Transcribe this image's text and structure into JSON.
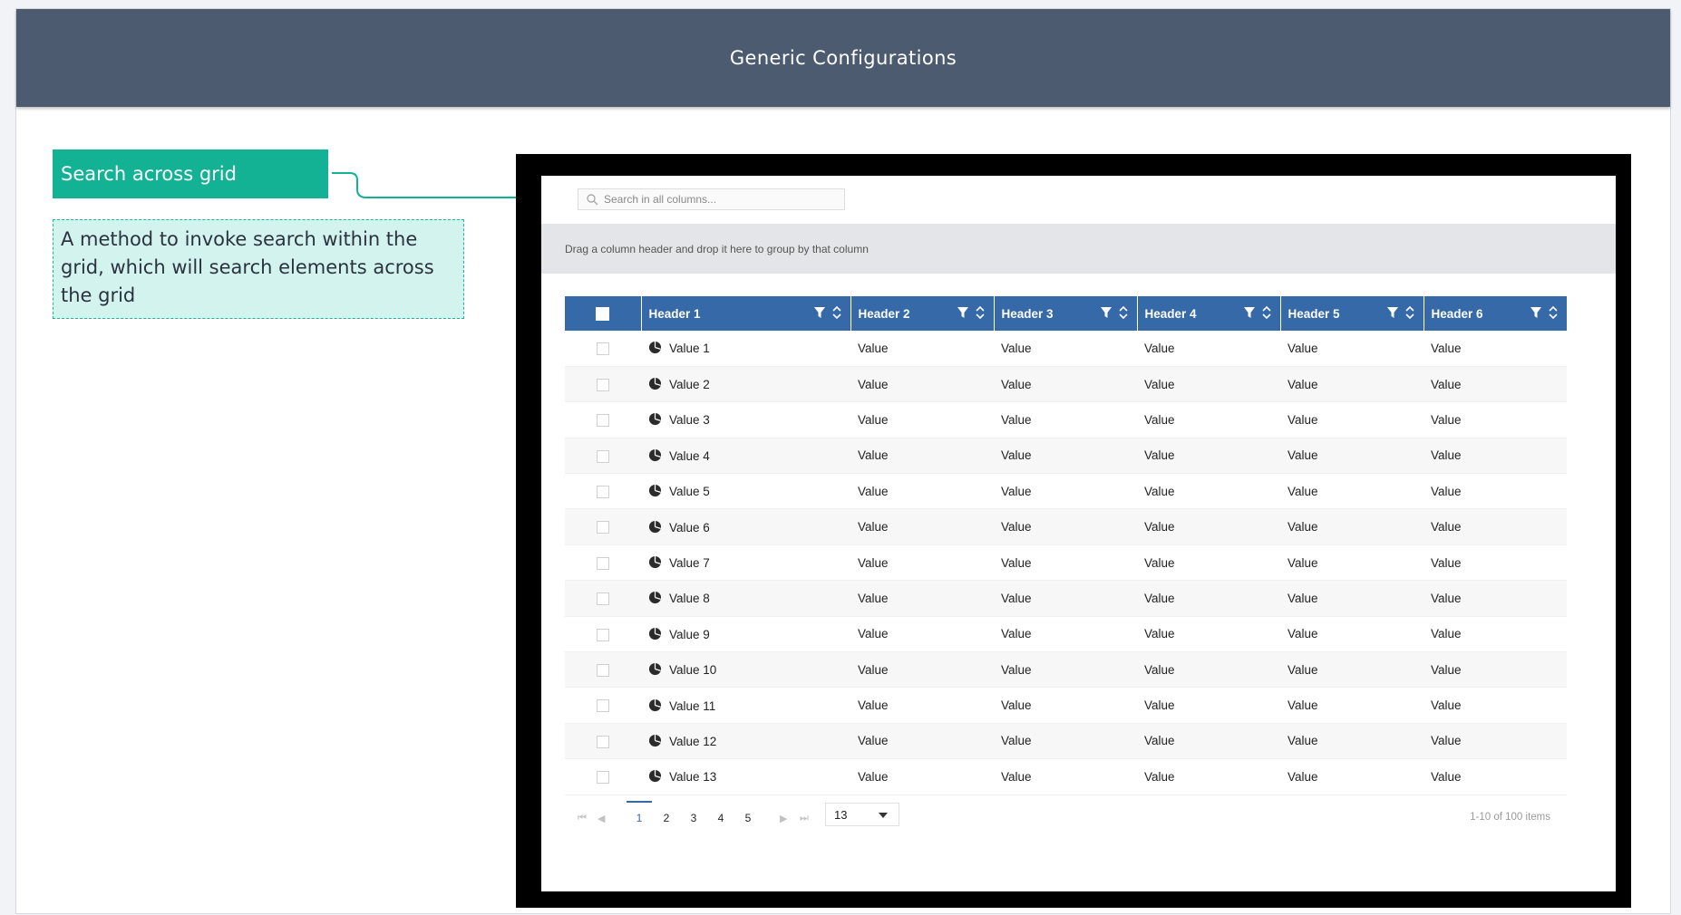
{
  "header": {
    "title": "Generic Configurations"
  },
  "callout": {
    "tag": "Search across grid",
    "description": "A method to invoke search within the grid, which will search elements  across the grid"
  },
  "grid": {
    "search_placeholder": "Search in all columns...",
    "group_hint": "Drag a column header and drop it here to group by that column",
    "headers": [
      "Header 1",
      "Header 2",
      "Header 3",
      "Header 4",
      "Header 5",
      "Header 6"
    ],
    "rows": [
      [
        "Value 1",
        "Value",
        "Value",
        "Value",
        "Value",
        "Value"
      ],
      [
        "Value 2",
        "Value",
        "Value",
        "Value",
        "Value",
        "Value"
      ],
      [
        "Value 3",
        "Value",
        "Value",
        "Value",
        "Value",
        "Value"
      ],
      [
        "Value 4",
        "Value",
        "Value",
        "Value",
        "Value",
        "Value"
      ],
      [
        "Value 5",
        "Value",
        "Value",
        "Value",
        "Value",
        "Value"
      ],
      [
        "Value 6",
        "Value",
        "Value",
        "Value",
        "Value",
        "Value"
      ],
      [
        "Value 7",
        "Value",
        "Value",
        "Value",
        "Value",
        "Value"
      ],
      [
        "Value 8",
        "Value",
        "Value",
        "Value",
        "Value",
        "Value"
      ],
      [
        "Value 9",
        "Value",
        "Value",
        "Value",
        "Value",
        "Value"
      ],
      [
        "Value 10",
        "Value",
        "Value",
        "Value",
        "Value",
        "Value"
      ],
      [
        "Value 11",
        "Value",
        "Value",
        "Value",
        "Value",
        "Value"
      ],
      [
        "Value 12",
        "Value",
        "Value",
        "Value",
        "Value",
        "Value"
      ],
      [
        "Value 13",
        "Value",
        "Value",
        "Value",
        "Value",
        "Value"
      ]
    ],
    "row_icon": "pie-chart-icon",
    "pager": {
      "pages": [
        "1",
        "2",
        "3",
        "4",
        "5"
      ],
      "current_page": "1",
      "page_size": "13",
      "info": "1-10 of 100 items"
    }
  },
  "colors": {
    "topbar": "#4c5b70",
    "accent": "#13b294",
    "callout_bg": "#d3f3ee",
    "grid_header": "#3569a8"
  }
}
